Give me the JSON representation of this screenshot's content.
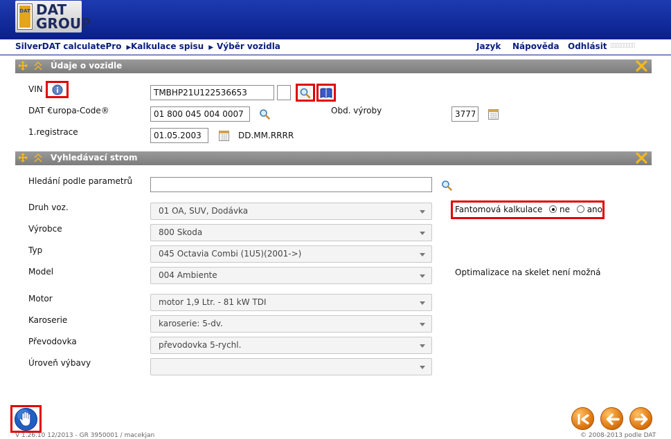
{
  "header": {
    "logo_badge": "DAT",
    "logo_line1": "DAT",
    "logo_line2": "GROUP"
  },
  "nav": {
    "breadcrumb": [
      "SilverDAT calculatePro",
      "Kalkulace spisu",
      "Výběr vozidla"
    ],
    "right": [
      "Jazyk",
      "Nápověda",
      "Odhlásit"
    ]
  },
  "vehicle_section": {
    "title": "Údaje o vozidle",
    "vin_label": "VIN",
    "vin_value": "TMBHP21U122536653",
    "vin_extra_value": "",
    "dat_code_label": "DAT €uropa-Code®",
    "dat_code_value": "01 800 045 004 0007",
    "production_period_label": "Obd. výroby",
    "production_period_value": "3777",
    "registration_label": "1.registrace",
    "registration_value": "01.05.2003",
    "date_format_hint": "DD.MM.RRRR"
  },
  "search_section": {
    "title": "Vyhledávací strom",
    "param_search_label": "Hledání podle parametrů",
    "param_search_value": "",
    "fields": [
      {
        "label": "Druh voz.",
        "value": "01 OA, SUV, Dodávka"
      },
      {
        "label": "Výrobce",
        "value": "800 Skoda"
      },
      {
        "label": "Typ",
        "value": "045 Octavia Combi (1U5)(2001->)"
      },
      {
        "label": "Model",
        "value": "004 Ambiente"
      },
      {
        "label": "Motor",
        "value": "motor 1,9 Ltr. - 81 kW TDI"
      },
      {
        "label": "Karoserie",
        "value": "karoserie: 5-dv."
      },
      {
        "label": "Převodovka",
        "value": "převodovka 5-rychl."
      },
      {
        "label": "Úroveň výbavy",
        "value": ""
      }
    ],
    "phantom_label": "Fantomová kalkulace",
    "phantom_no": "ne",
    "phantom_yes": "ano",
    "phantom_selected": "ne",
    "skeleton_note": "Optimalizace na skelet není možná"
  },
  "footer": {
    "version_info": "V 1.26.10   12/2013 - GR    3950001 / macekjan",
    "copyright": "© 2008-2013  podle DAT"
  },
  "colors": {
    "header_blue": "#0a1f8c",
    "section_gray": "#8a8a8a",
    "accent_orange": "#e07a12",
    "highlight_red": "#e00000"
  }
}
